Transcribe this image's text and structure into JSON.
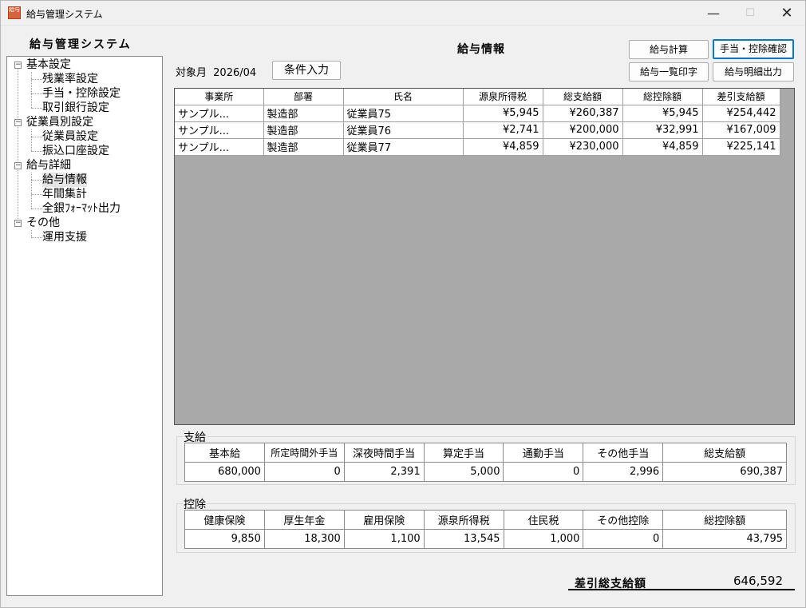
{
  "window": {
    "title": "給与管理システム",
    "icon_text": "給与",
    "minimize_icon": "—",
    "maximize_icon": "☐",
    "close_icon": "✕"
  },
  "sidebar": {
    "title": "給与管理システム",
    "tree": [
      {
        "label": "基本設定",
        "children": [
          "残業率設定",
          "手当・控除設定",
          "取引銀行設定"
        ]
      },
      {
        "label": "従業員別設定",
        "children": [
          "従業員設定",
          "振込口座設定"
        ]
      },
      {
        "label": "給与詳細",
        "children": [
          "給与情報",
          "年間集計",
          "全銀ﾌｫｰﾏｯﾄ出力"
        ]
      },
      {
        "label": "その他",
        "children": [
          "運用支援"
        ]
      }
    ],
    "selected": "給与情報"
  },
  "header": {
    "title": "給与情報",
    "month_label": "対象月",
    "month_value": "2026/04",
    "condition_button": "条件入力",
    "buttons": {
      "calc": "給与計算",
      "allowance_check": "手当・控除確認",
      "list_print": "給与一覧印字",
      "detail_output": "給与明細出力"
    }
  },
  "grid": {
    "columns": [
      "事業所",
      "部署",
      "氏名",
      "源泉所得税",
      "総支給額",
      "総控除額",
      "差引支給額"
    ],
    "rows": [
      [
        "サンプル...",
        "製造部",
        "従業員75",
        "¥5,945",
        "¥260,387",
        "¥5,945",
        "¥254,442"
      ],
      [
        "サンプル...",
        "製造部",
        "従業員76",
        "¥2,741",
        "¥200,000",
        "¥32,991",
        "¥167,009"
      ],
      [
        "サンプル...",
        "製造部",
        "従業員77",
        "¥4,859",
        "¥230,000",
        "¥4,859",
        "¥225,141"
      ]
    ]
  },
  "payment": {
    "label": "支給",
    "headers": [
      "基本給",
      "所定時間外手当",
      "深夜時間手当",
      "算定手当",
      "通勤手当",
      "その他手当",
      "総支給額"
    ],
    "values": [
      "680,000",
      "0",
      "2,391",
      "5,000",
      "0",
      "2,996",
      "690,387"
    ]
  },
  "deduction": {
    "label": "控除",
    "headers": [
      "健康保険",
      "厚生年金",
      "雇用保険",
      "源泉所得税",
      "住民税",
      "その他控除",
      "総控除額"
    ],
    "values": [
      "9,850",
      "18,300",
      "1,100",
      "13,545",
      "1,000",
      "0",
      "43,795"
    ]
  },
  "net": {
    "label": "差引総支給額",
    "value": "646,592"
  }
}
